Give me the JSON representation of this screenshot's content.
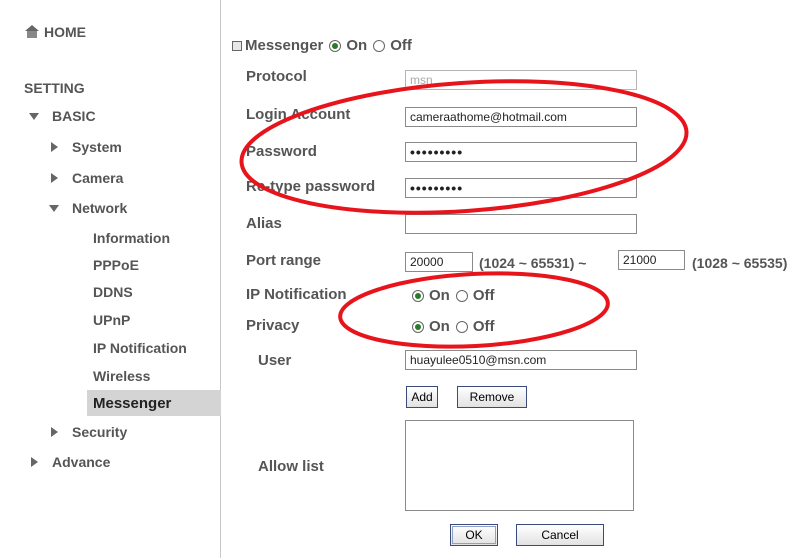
{
  "sidebar": {
    "home": "HOME",
    "setting": "SETTING",
    "basic": "BASIC",
    "system": "System",
    "camera": "Camera",
    "network": "Network",
    "network_items": [
      "Information",
      "PPPoE",
      "DDNS",
      "UPnP",
      "IP Notification",
      "Wireless",
      "Messenger"
    ],
    "security": "Security",
    "advance": "Advance"
  },
  "messenger": {
    "label": "Messenger",
    "on": "On",
    "off": "Off",
    "state": "On"
  },
  "form": {
    "protocol_label": "Protocol",
    "protocol_value": "msn",
    "login_label": "Login Account",
    "login_value": "cameraathome@hotmail.com",
    "password_label": "Password",
    "password_value": "•••••••••",
    "retype_label": "Re-type password",
    "retype_value": "•••••••••",
    "alias_label": "Alias",
    "alias_value": "",
    "port_label": "Port range",
    "port_start": "20000",
    "port_start_range": "(1024 ~ 65531) ~",
    "port_end": "21000",
    "port_end_range": "(1028 ~ 65535)",
    "ipnotify_label": "IP Notification",
    "privacy_label": "Privacy",
    "on": "On",
    "off": "Off",
    "ipnotify_state": "On",
    "privacy_state": "On",
    "user_label": "User",
    "user_value": "huayulee0510@msn.com",
    "add_btn": "Add",
    "remove_btn": "Remove",
    "allow_label": "Allow list",
    "ok_btn": "OK",
    "cancel_btn": "Cancel"
  },
  "annotation_color": "#e8141c"
}
